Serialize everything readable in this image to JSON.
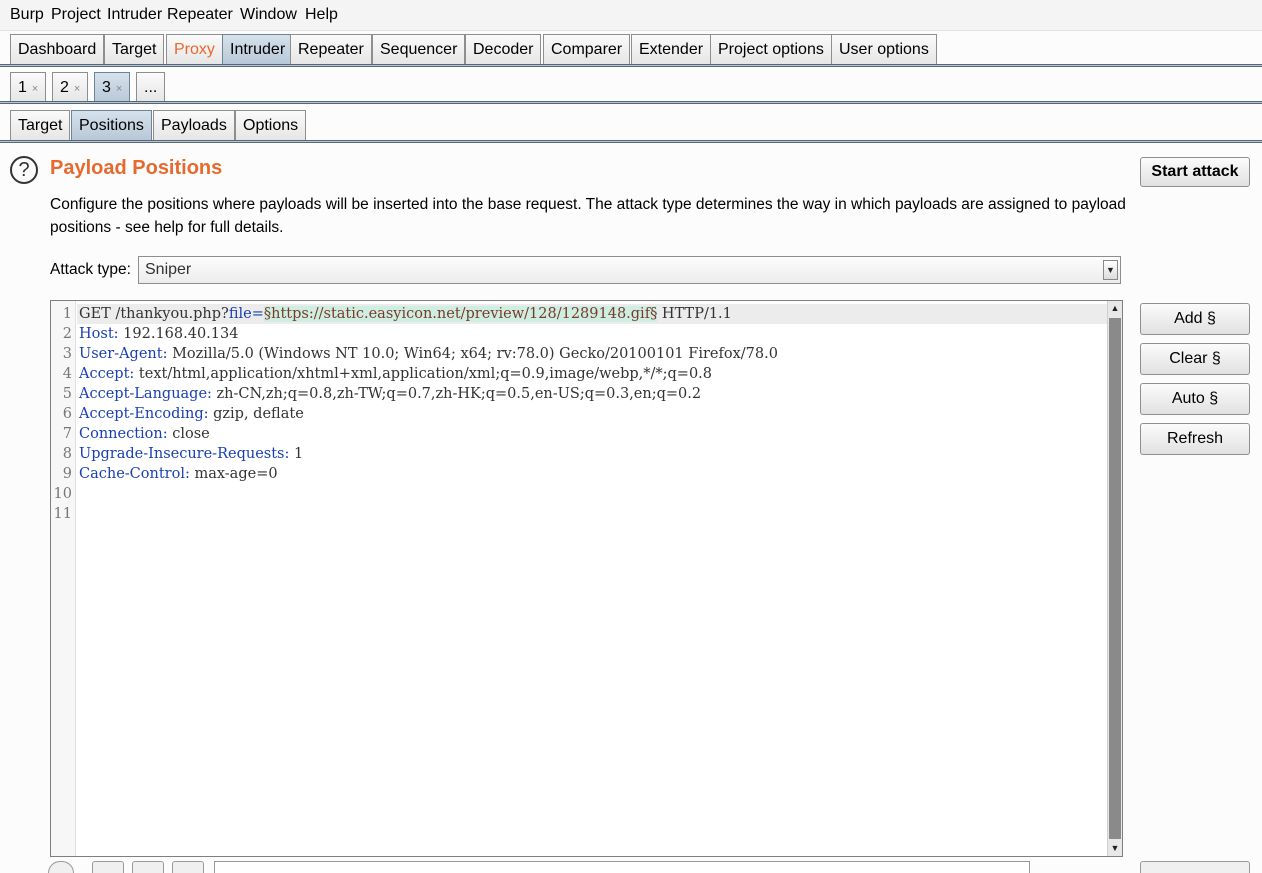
{
  "menubar": {
    "items": [
      "Burp",
      "Project",
      "Intruder",
      "Repeater",
      "Window",
      "Help"
    ]
  },
  "main_tabs": {
    "items": [
      "Dashboard",
      "Target",
      "Proxy",
      "Intruder",
      "Repeater",
      "Sequencer",
      "Decoder",
      "Comparer",
      "Extender",
      "Project options",
      "User options"
    ],
    "active": "Intruder",
    "highlighted": "Proxy"
  },
  "attack_tabs": {
    "items": [
      "1",
      "2",
      "3",
      "..."
    ],
    "close_glyph": "×",
    "active": "3"
  },
  "sub_tabs": {
    "items": [
      "Target",
      "Positions",
      "Payloads",
      "Options"
    ],
    "active": "Positions"
  },
  "section": {
    "help_glyph": "?",
    "title": "Payload Positions",
    "description": "Configure the positions where payloads will be inserted into the base request. The attack type determines the way in which payloads are assigned to payload positions - see help for full details."
  },
  "start_attack_label": "Start attack",
  "attack_type": {
    "label": "Attack type:",
    "value": "Sniper"
  },
  "side_buttons": [
    "Add §",
    "Clear §",
    "Auto §",
    "Refresh"
  ],
  "editor": {
    "line_numbers": [
      "1",
      "2",
      "3",
      "4",
      "5",
      "6",
      "7",
      "8",
      "9",
      "10",
      "11"
    ],
    "request_line": {
      "method": "GET /thankyou.php?",
      "param": "file=",
      "payload": "§https://static.easyicon.net/preview/128/1289148.gif§",
      "rest": " HTTP/1.1"
    },
    "headers": [
      {
        "name": "Host",
        "value": " 192.168.40.134"
      },
      {
        "name": "User-Agent",
        "value": " Mozilla/5.0 (Windows NT 10.0; Win64; x64; rv:78.0) Gecko/20100101 Firefox/78.0"
      },
      {
        "name": "Accept",
        "value": " text/html,application/xhtml+xml,application/xml;q=0.9,image/webp,*/*;q=0.8"
      },
      {
        "name": "Accept-Language",
        "value": " zh-CN,zh;q=0.8,zh-TW;q=0.7,zh-HK;q=0.5,en-US;q=0.3,en;q=0.2"
      },
      {
        "name": "Accept-Encoding",
        "value": " gzip, deflate"
      },
      {
        "name": "Connection",
        "value": " close"
      },
      {
        "name": "Upgrade-Insecure-Requests",
        "value": " 1"
      },
      {
        "name": "Cache-Control",
        "value": " max-age=0"
      }
    ],
    "colon": ":"
  },
  "colors": {
    "accent_orange": "#e8692d",
    "header_blue": "#1a3fb4",
    "payload_bg": "#cfeee2",
    "active_tab": "#b8c8d8"
  }
}
